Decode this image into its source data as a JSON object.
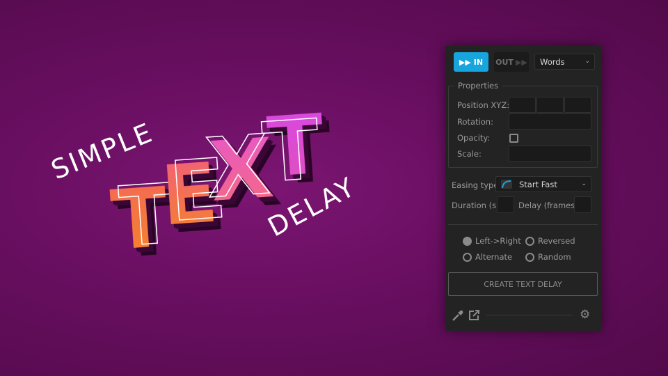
{
  "artwork": {
    "word1": "SIMPLE",
    "word2": [
      "T",
      "E",
      "X",
      "T"
    ],
    "word3": "DELAY",
    "colors": {
      "t1": "#f57a2a",
      "e": "#f4704e",
      "x": "#f060b0",
      "t2": "#d040d8"
    }
  },
  "panel": {
    "in_label": "IN",
    "out_label": "OUT",
    "split_select": {
      "value": "Words"
    },
    "properties": {
      "legend": "Properties",
      "position_label": "Position XYZ:",
      "rotation_label": "Rotation:",
      "opacity_label": "Opacity:",
      "scale_label": "Scale:"
    },
    "easing": {
      "label": "Easing type",
      "value": "Start Fast"
    },
    "duration_label": "Duration (s)",
    "delay_label": "Delay (frames)",
    "order": {
      "options": [
        "Left->Right",
        "Reversed",
        "Alternate",
        "Random"
      ],
      "selected": "Left->Right"
    },
    "create_label": "CREATE TEXT DELAY",
    "accent": "#18a4dc"
  }
}
